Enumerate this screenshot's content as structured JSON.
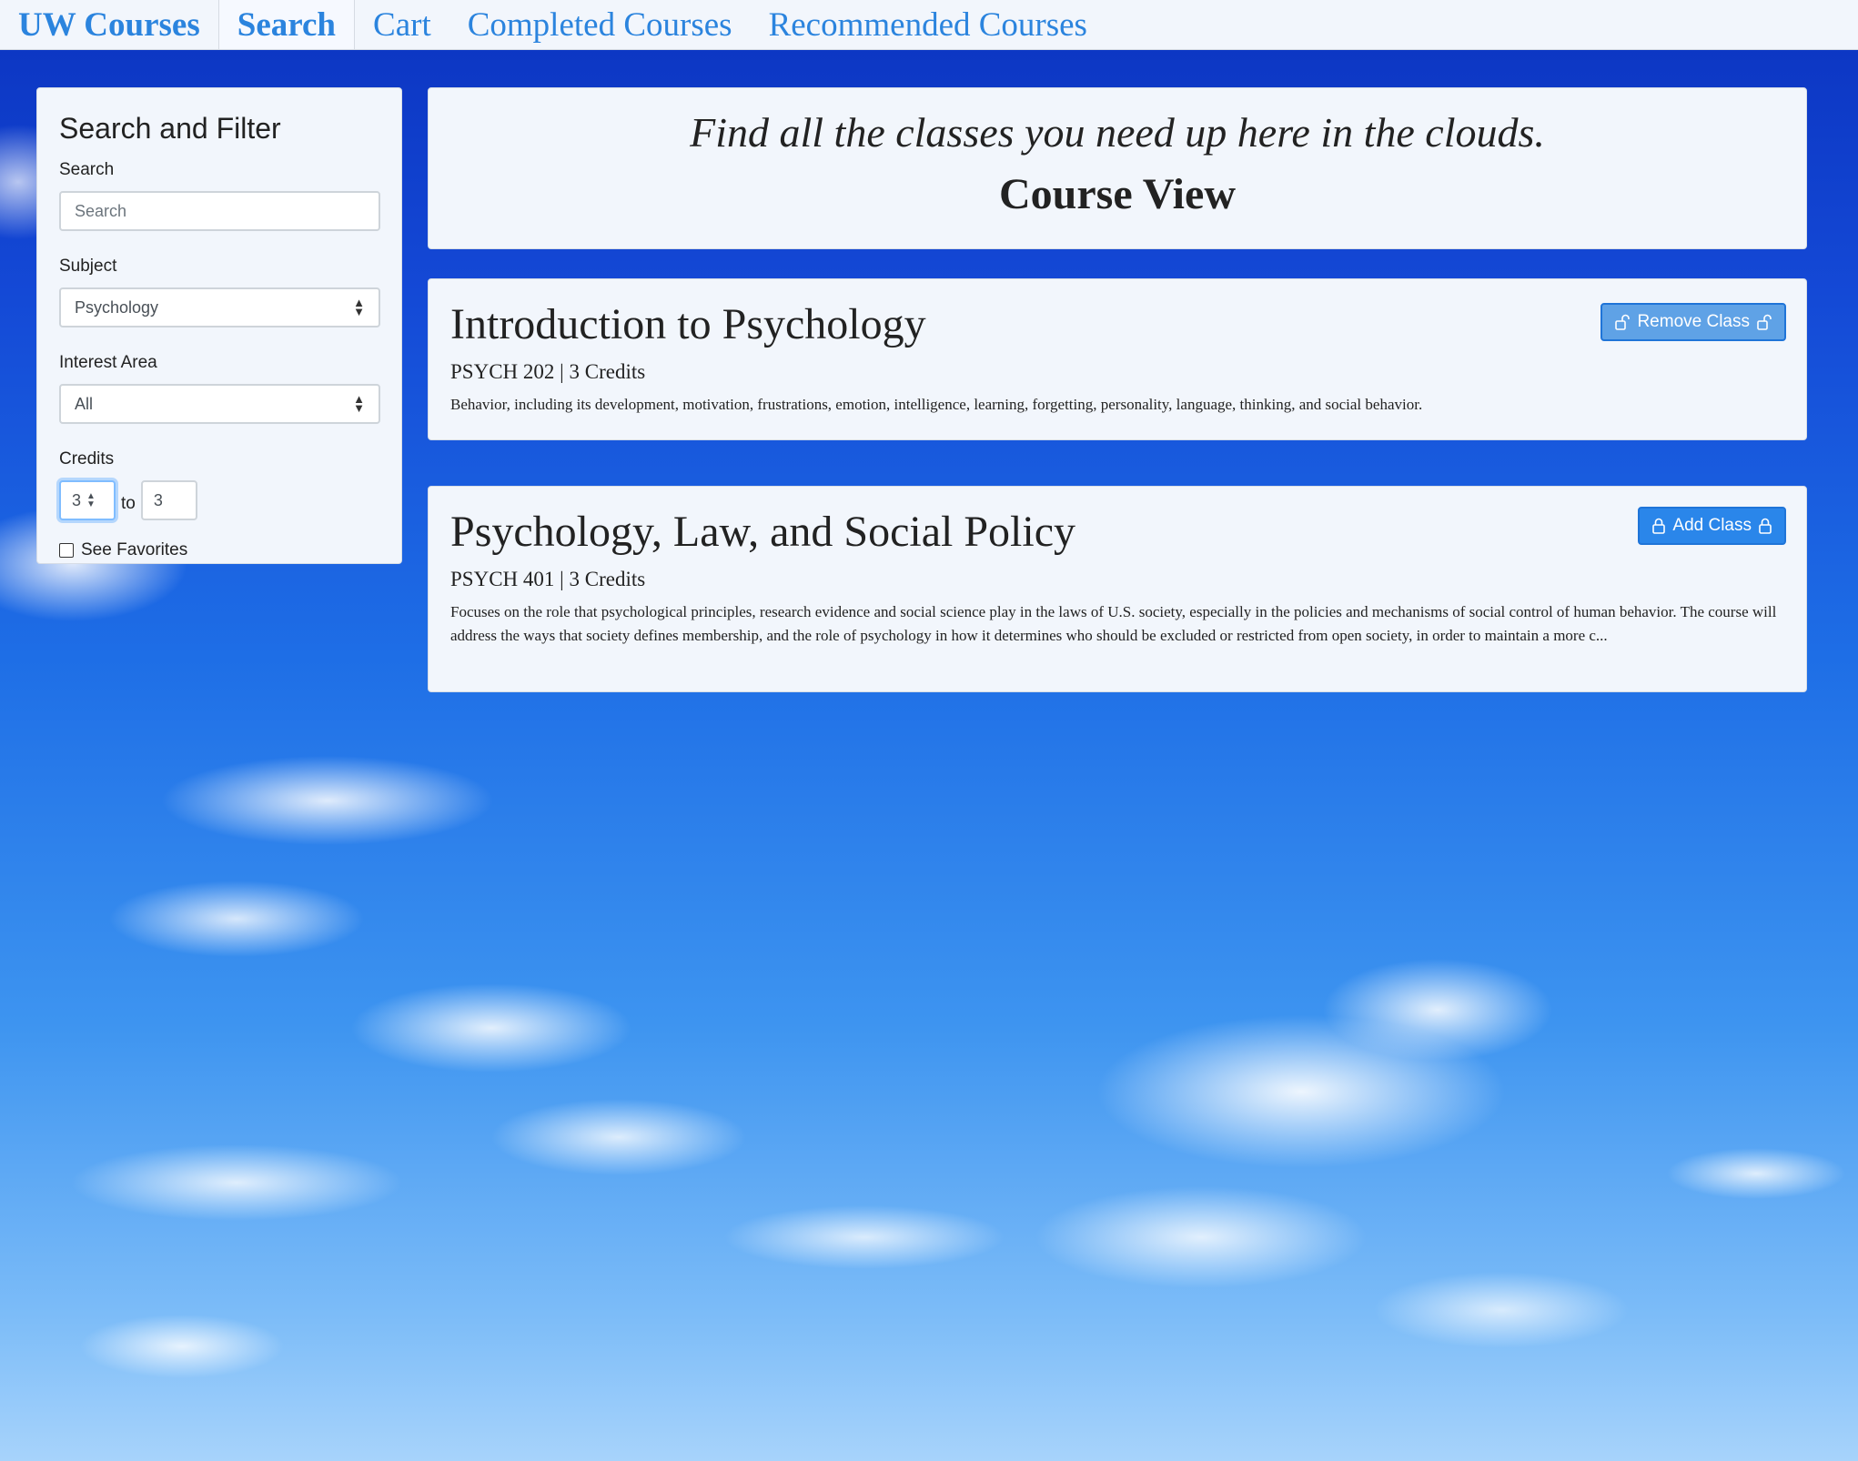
{
  "nav": {
    "brand": "UW Courses",
    "items": [
      {
        "label": "Search",
        "active": true
      },
      {
        "label": "Cart",
        "active": false
      },
      {
        "label": "Completed Courses",
        "active": false
      },
      {
        "label": "Recommended Courses",
        "active": false
      }
    ]
  },
  "sidebar": {
    "title": "Search and Filter",
    "search_label": "Search",
    "search_placeholder": "Search",
    "subject_label": "Subject",
    "subject_value": "Psychology",
    "interest_label": "Interest Area",
    "interest_value": "All",
    "credits_label": "Credits",
    "credits_min": "3",
    "credits_to": "to",
    "credits_max": "3",
    "favorites_label": "See Favorites"
  },
  "hero": {
    "tagline": "Find all the classes you need up here in the clouds.",
    "title": "Course View"
  },
  "courses": [
    {
      "title": "Introduction to Psychology",
      "meta": "PSYCH 202 | 3 Credits",
      "description": "Behavior, including its development, motivation, frustrations, emotion, intelligence, learning, forgetting, personality, language, thinking, and social behavior.",
      "button": "Remove Class",
      "button_icon": "unlock-icon"
    },
    {
      "title": "Psychology, Law, and Social Policy",
      "meta": "PSYCH 401 | 3 Credits",
      "description": "Focuses on the role that psychological principles, research evidence and social science play in the laws of U.S. society, especially in the policies and mechanisms of social control of human behavior. The course will address the ways that society defines membership, and the role of psychology in how it determines who should be excluded or restricted from open society, in order to maintain a more c...",
      "button": "Add Class",
      "button_icon": "lock-icon"
    }
  ],
  "colors": {
    "accent": "#2b84de",
    "panel": "#f2f6fc",
    "button_add": "#2a86ea",
    "button_remove": "#5fa2e6"
  }
}
